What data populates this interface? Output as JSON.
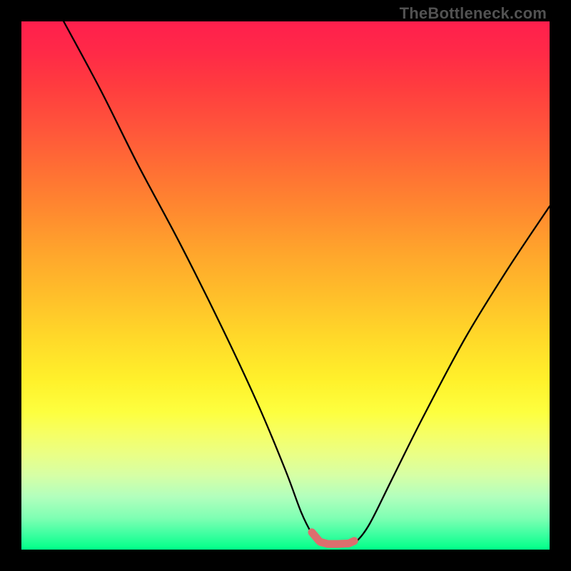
{
  "watermark": "TheBottleneck.com",
  "colors": {
    "bg": "#000000",
    "curve": "#000000",
    "optimal_marker": "#dc6e6e",
    "gradient_top": "#ff1f4d",
    "gradient_bottom": "#00ff88"
  },
  "chart_data": {
    "type": "line",
    "title": "",
    "xlabel": "",
    "ylabel": "",
    "xlim": [
      0,
      100
    ],
    "ylim": [
      0,
      100
    ],
    "grid": false,
    "series": [
      {
        "name": "bottleneck-curve",
        "x": [
          8,
          15,
          22,
          30,
          38,
          45,
          50,
          53,
          55,
          56.5,
          58,
          60,
          62,
          63.5,
          66,
          70,
          76,
          84,
          92,
          100
        ],
        "y": [
          100,
          87,
          73,
          58,
          42,
          27,
          15,
          7,
          3,
          1.2,
          0.8,
          0.8,
          0.9,
          1.6,
          5,
          13,
          25,
          40,
          53,
          65
        ]
      }
    ],
    "annotations": [
      {
        "name": "optimal-range-marker",
        "x_range": [
          55,
          63
        ],
        "y": 1,
        "color": "#dc6e6e"
      }
    ]
  }
}
